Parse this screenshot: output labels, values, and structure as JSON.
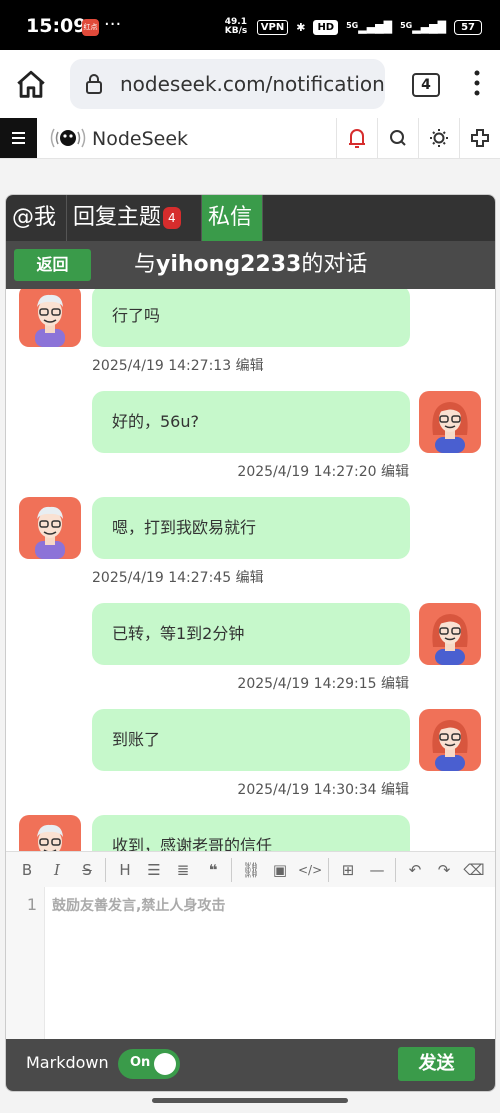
{
  "status_bar": {
    "time": "15:09",
    "app_badge": "红点",
    "more": "···",
    "net_speed": "49.1 KB/s",
    "vpn": "VPN",
    "hd": "HD",
    "signal1": "5G",
    "signal2": "5G",
    "battery": "57"
  },
  "browser": {
    "url": "nodeseek.com/notification#/m",
    "tab_count": "4"
  },
  "site": {
    "name": "NodeSeek"
  },
  "tabs": {
    "at_me": "@我",
    "reply": "回复主题",
    "reply_badge": "4",
    "private_msg": "私信"
  },
  "conversation": {
    "back_label": "返回",
    "title_prefix": "与",
    "user": "yihong2233",
    "title_suffix": "的对话"
  },
  "messages": [
    {
      "side": "left",
      "text": "行了吗",
      "time": "2025/4/19 14:27:13",
      "edit": "编辑"
    },
    {
      "side": "right",
      "text": "好的，56u?",
      "time": "2025/4/19 14:27:20",
      "edit": "编辑"
    },
    {
      "side": "left",
      "text": "嗯，打到我欧易就行",
      "time": "2025/4/19 14:27:45",
      "edit": "编辑"
    },
    {
      "side": "right",
      "text": "已转，等1到2分钟",
      "time": "2025/4/19 14:29:15",
      "edit": "编辑"
    },
    {
      "side": "right",
      "text": "到账了",
      "time": "2025/4/19 14:30:34",
      "edit": "编辑"
    },
    {
      "side": "left",
      "text": "收到，感谢老哥的信任",
      "time": "",
      "edit": ""
    }
  ],
  "editor": {
    "toolbar": [
      "B",
      "I",
      "S",
      "H",
      "ul",
      "ol",
      "quote",
      "link",
      "image",
      "code",
      "table",
      "hr",
      "undo",
      "redo",
      "eraser"
    ],
    "line_number": "1",
    "placeholder": "鼓励友善发言,禁止人身攻击"
  },
  "footer": {
    "markdown_label": "Markdown",
    "toggle_label": "On",
    "send_label": "发送"
  },
  "colors": {
    "accent_green": "#3a9b4a",
    "bubble_green": "#c6f8cb",
    "dark_bar": "#333333",
    "badge_red": "#d62d2d"
  }
}
